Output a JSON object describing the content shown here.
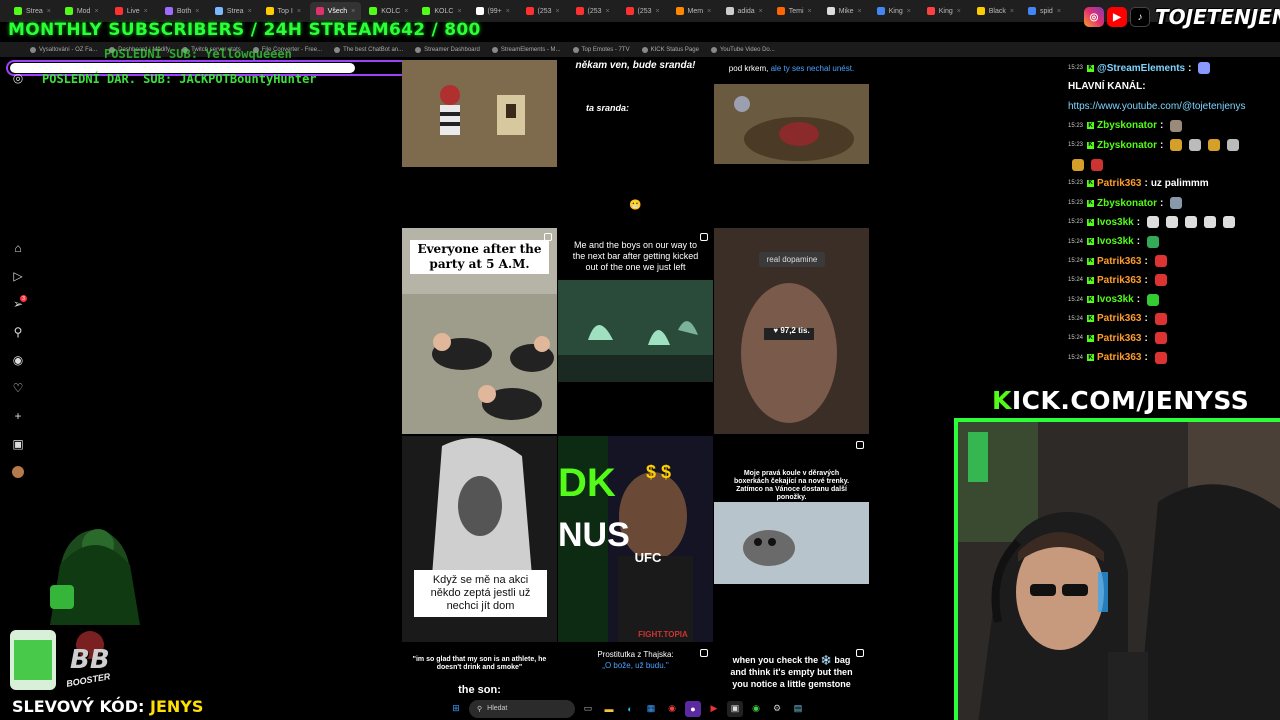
{
  "browser": {
    "tabs": [
      {
        "label": "Strea",
        "color": "#53fc18",
        "active": false
      },
      {
        "label": "Mod",
        "color": "#53fc18",
        "active": false
      },
      {
        "label": "Live",
        "color": "#ff3030",
        "active": false
      },
      {
        "label": "Both",
        "color": "#9b6cff",
        "active": false
      },
      {
        "label": "Strea",
        "color": "#7ab7ff",
        "active": false
      },
      {
        "label": "Top I",
        "color": "#ffcc00",
        "active": false
      },
      {
        "label": "Všech",
        "color": "#e1306c",
        "active": true
      },
      {
        "label": "KOLC",
        "color": "#53fc18",
        "active": false
      },
      {
        "label": "KOLC",
        "color": "#53fc18",
        "active": false
      },
      {
        "label": "(99+",
        "color": "#ffffff",
        "active": false
      },
      {
        "label": "(253",
        "color": "#ff3030",
        "active": false
      },
      {
        "label": "(253",
        "color": "#ff3030",
        "active": false
      },
      {
        "label": "(253",
        "color": "#ff3030",
        "active": false
      },
      {
        "label": "Mem",
        "color": "#ff8800",
        "active": false
      },
      {
        "label": "adida",
        "color": "#cccccc",
        "active": false
      },
      {
        "label": "Temi",
        "color": "#ff6600",
        "active": false
      },
      {
        "label": "Mike",
        "color": "#dddddd",
        "active": false
      },
      {
        "label": "King",
        "color": "#4285f4",
        "active": false
      },
      {
        "label": "King",
        "color": "#ff4040",
        "active": false
      },
      {
        "label": "Black",
        "color": "#ffcc00",
        "active": false
      },
      {
        "label": "spid",
        "color": "#4285f4",
        "active": false
      }
    ],
    "bookmarks": [
      "Vysaltování - OZ Fa...",
      "Dashboard | Modify",
      "Twitch server stats",
      "File Converter - Free...",
      "The best ChatBot an...",
      "Streamer Dashboard",
      "StreamElements - M...",
      "Top Emotes - 7TV",
      "KICK Status Page",
      "YouTube Video Do..."
    ]
  },
  "overlay": {
    "banner": "MONTHLY SUBSCRIBERS / 24H STREAM642 / 800",
    "last_sub": "POSLEDNÍ SUB: Yellowqueeen",
    "last_donation": "POSLEDNÍ DAR. SUB: JACKPOTBountyHunter",
    "social_handle": "TOJETENJENYS",
    "kick_url_k": "K",
    "kick_url_rest": "ICK.COM/JENYSS",
    "promo_label": "SLEVOVÝ KÓD: ",
    "promo_code": "JENYS",
    "booster_text": "BOOSTER"
  },
  "nav": {
    "notification_count": "3"
  },
  "grid": {
    "tiles": [
      {
        "caption": "",
        "bg": "#6b5a44"
      },
      {
        "caption": "někam ven, bude sranda!",
        "caption2": "ta sranda:",
        "emoji": "😬",
        "bg": "#000000"
      },
      {
        "caption": "pod krkem, ",
        "caption_link": "ale ty ses nechal unést.",
        "bg": "#000000"
      },
      {
        "caption": "Everyone after the party at 5 A.M.",
        "bg": "#b5b4a6"
      },
      {
        "caption": "Me and the boys on our way to the next bar after getting kicked out of the one we just left",
        "bg": "#000000"
      },
      {
        "caption": "real dopamine",
        "likes": "97,2 tis.",
        "bg": "#4a3a2e"
      },
      {
        "caption": "Když se mě na akci někdo zeptá jestli už nechci jít dom",
        "bg": "#222222"
      },
      {
        "caption": "UFC",
        "caption2": "FIGHT.TOPIA",
        "bg": "#1a1a2a"
      },
      {
        "caption": "Moje pravá koule v děravých boxerkách čekající na nové trenky. Zatímco na Vánoce dostanu další ponožky.",
        "bg": "#000000"
      },
      {
        "caption": "\"im so glad that my son is an athlete, he doesn't drink and smoke\"",
        "caption2": "the son:",
        "bg": "#000000"
      },
      {
        "caption": "Prostitutka z Thajska:",
        "caption_link": "„O bože, už budu.\"",
        "bg": "#000000"
      },
      {
        "caption": "when you check the ❄️ bag and think it's empty but then you notice a little gemstone",
        "bg": "#000000"
      }
    ]
  },
  "chat": {
    "messages": [
      {
        "time": "15:23",
        "user": "@StreamElements",
        "text": "",
        "color": "#7fd4ff",
        "emotes": [
          "#8899ff"
        ]
      },
      {
        "time": "",
        "user": "",
        "text": "HLAVNÍ KANÁL:",
        "color": "#ffffff",
        "emotes": []
      },
      {
        "time": "",
        "user": "",
        "text": "https://www.youtube.com/@tojetenjenys",
        "color": "#7fd4ff",
        "emotes": [],
        "link": true
      },
      {
        "time": "15:23",
        "user": "Zbyskonator",
        "text": "",
        "color": "#53fc18",
        "emotes": [
          "#9a8a7a"
        ]
      },
      {
        "time": "15:23",
        "user": "Zbyskonator",
        "text": "",
        "color": "#53fc18",
        "emotes": [
          "#d4a02a",
          "#bbbbbb",
          "#d4a02a",
          "#bbbbbb"
        ]
      },
      {
        "time": "",
        "user": "",
        "text": "",
        "color": "#ffffff",
        "emotes": [
          "#d4a02a",
          "#cc3333"
        ]
      },
      {
        "time": "15:23",
        "user": "Patrik363",
        "text": "uz palimmm",
        "color": "#ff9d2b",
        "emotes": []
      },
      {
        "time": "15:23",
        "user": "Zbyskonator",
        "text": "",
        "color": "#53fc18",
        "emotes": [
          "#8899aa"
        ]
      },
      {
        "time": "15:23",
        "user": "Ivos3kk",
        "text": "",
        "color": "#53fc18",
        "emotes": [
          "#dddddd",
          "#dddddd",
          "#dddddd",
          "#dddddd",
          "#dddddd"
        ]
      },
      {
        "time": "15:24",
        "user": "Ivos3kk",
        "text": "",
        "color": "#53fc18",
        "emotes": [
          "#33aa55"
        ]
      },
      {
        "time": "15:24",
        "user": "Patrik363",
        "text": "",
        "color": "#ff9d2b",
        "emotes": [
          "#dd3333"
        ]
      },
      {
        "time": "15:24",
        "user": "Patrik363",
        "text": "",
        "color": "#ff9d2b",
        "emotes": [
          "#dd3333"
        ]
      },
      {
        "time": "15:24",
        "user": "Ivos3kk",
        "text": "",
        "color": "#53fc18",
        "emotes": [
          "#33cc33"
        ]
      },
      {
        "time": "15:24",
        "user": "Patrik363",
        "text": "",
        "color": "#ff9d2b",
        "emotes": [
          "#dd3333"
        ]
      },
      {
        "time": "15:24",
        "user": "Patrik363",
        "text": "",
        "color": "#ff9d2b",
        "emotes": [
          "#dd3333"
        ]
      },
      {
        "time": "15:24",
        "user": "Patrik363",
        "text": "",
        "color": "#ff9d2b",
        "emotes": [
          "#dd3333"
        ]
      }
    ]
  },
  "taskbar": {
    "search_placeholder": "Hledat"
  },
  "colors": {
    "kick_green": "#53fc18",
    "banner_green": "#2bff3a",
    "promo_yellow": "#ffe000",
    "frame_purple": "#a040ff"
  }
}
